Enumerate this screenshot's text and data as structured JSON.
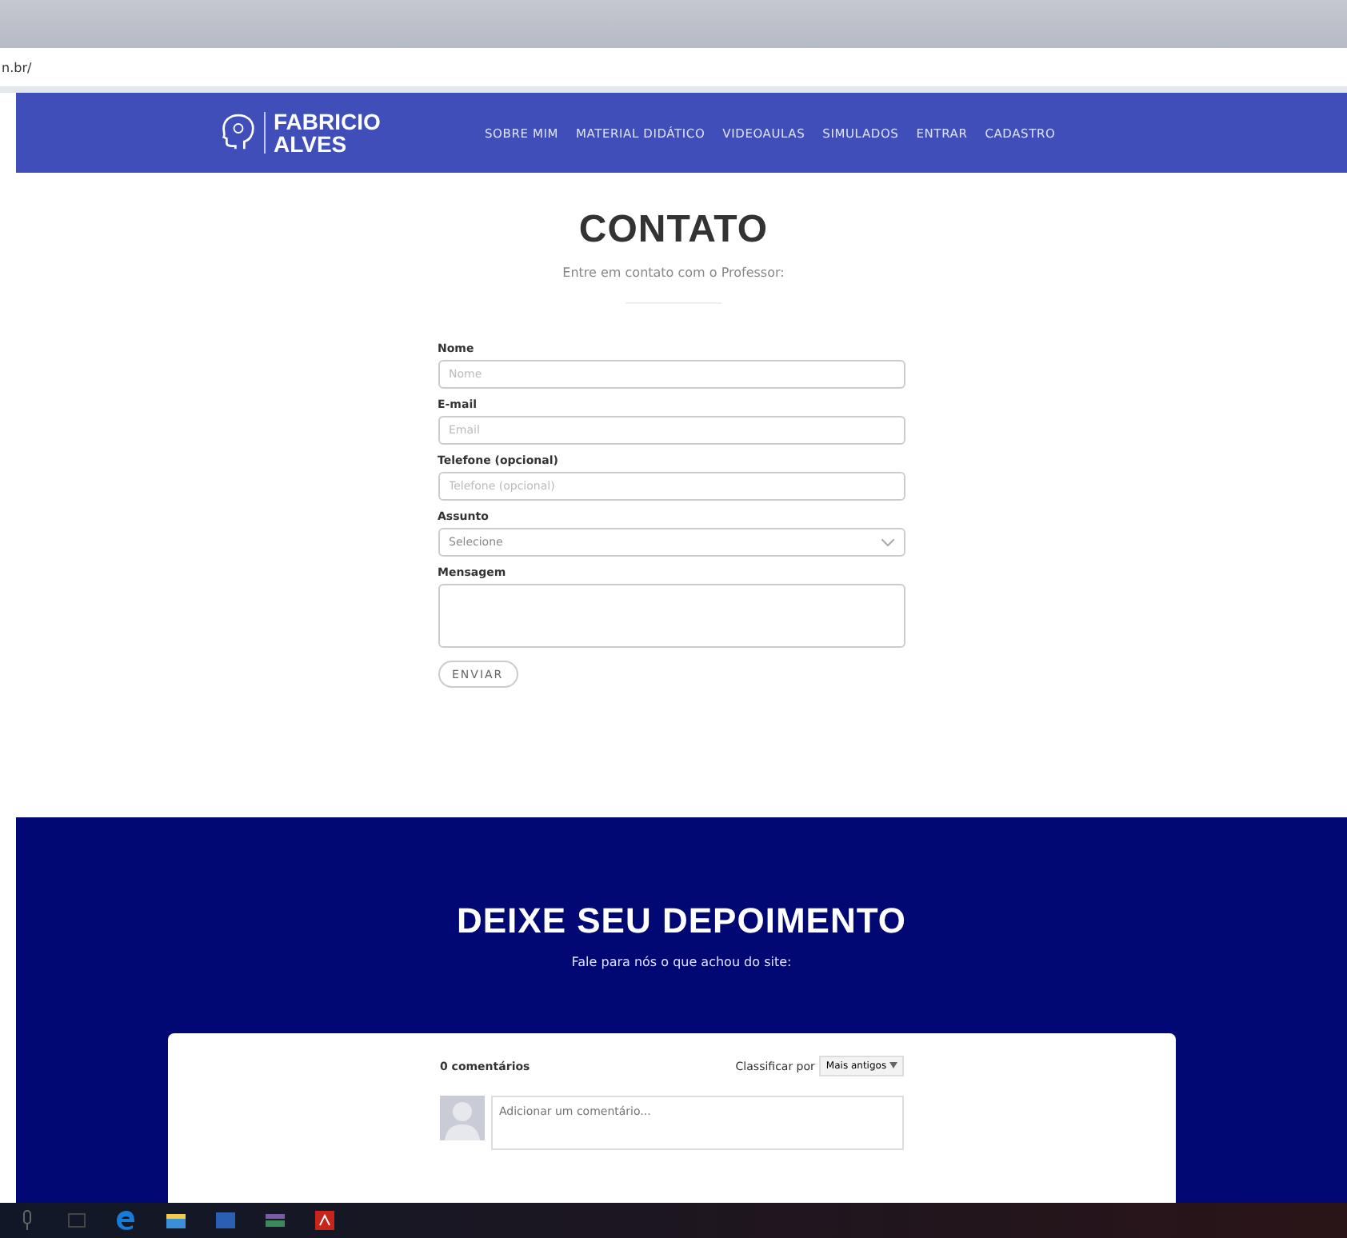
{
  "browser": {
    "address": "n.br/"
  },
  "nav": {
    "logo_line1": "FABRICIO",
    "logo_line2": "ALVES",
    "items": [
      "SOBRE MIM",
      "MATERIAL DIDÁTICO",
      "VIDEOAULAS",
      "SIMULADOS",
      "ENTRAR",
      "CADASTRO"
    ]
  },
  "contact": {
    "title": "CONTATO",
    "subtitle": "Entre em contato com o Professor:",
    "fields": [
      {
        "label": "Nome",
        "kind": "input",
        "placeholder": "Nome"
      },
      {
        "label": "E-mail",
        "kind": "input",
        "placeholder": "Email"
      },
      {
        "label": "Telefone (opcional)",
        "kind": "input",
        "placeholder": "Telefone (opcional)"
      },
      {
        "label": "Assunto",
        "kind": "select",
        "value": "Selecione"
      },
      {
        "label": "Mensagem",
        "kind": "textarea"
      }
    ],
    "submit": "ENVIAR"
  },
  "testimonial": {
    "title": "DEIXE SEU DEPOIMENTO",
    "subtitle": "Fale para nós o que achou do site:",
    "comments": {
      "count": "0 comentários",
      "sort_label": "Classificar por",
      "sort_value": "Mais antigos",
      "input_placeholder": "Adicionar um comentário..."
    }
  },
  "taskbar": {
    "items": [
      {
        "kind": "mic"
      },
      {
        "kind": "taskview"
      },
      {
        "kind": "edge"
      },
      {
        "kind": "folder"
      },
      {
        "kind": "word"
      },
      {
        "kind": "app"
      },
      {
        "kind": "pdf"
      }
    ]
  }
}
